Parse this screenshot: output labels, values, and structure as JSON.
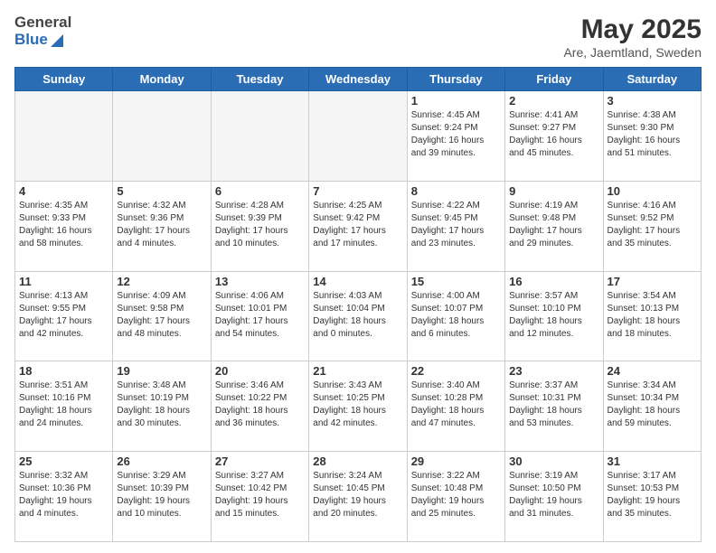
{
  "logo": {
    "general": "General",
    "blue": "Blue"
  },
  "header": {
    "month": "May 2025",
    "location": "Are, Jaemtland, Sweden"
  },
  "weekdays": [
    "Sunday",
    "Monday",
    "Tuesday",
    "Wednesday",
    "Thursday",
    "Friday",
    "Saturday"
  ],
  "weeks": [
    [
      {
        "day": "",
        "info": ""
      },
      {
        "day": "",
        "info": ""
      },
      {
        "day": "",
        "info": ""
      },
      {
        "day": "",
        "info": ""
      },
      {
        "day": "1",
        "info": "Sunrise: 4:45 AM\nSunset: 9:24 PM\nDaylight: 16 hours\nand 39 minutes."
      },
      {
        "day": "2",
        "info": "Sunrise: 4:41 AM\nSunset: 9:27 PM\nDaylight: 16 hours\nand 45 minutes."
      },
      {
        "day": "3",
        "info": "Sunrise: 4:38 AM\nSunset: 9:30 PM\nDaylight: 16 hours\nand 51 minutes."
      }
    ],
    [
      {
        "day": "4",
        "info": "Sunrise: 4:35 AM\nSunset: 9:33 PM\nDaylight: 16 hours\nand 58 minutes."
      },
      {
        "day": "5",
        "info": "Sunrise: 4:32 AM\nSunset: 9:36 PM\nDaylight: 17 hours\nand 4 minutes."
      },
      {
        "day": "6",
        "info": "Sunrise: 4:28 AM\nSunset: 9:39 PM\nDaylight: 17 hours\nand 10 minutes."
      },
      {
        "day": "7",
        "info": "Sunrise: 4:25 AM\nSunset: 9:42 PM\nDaylight: 17 hours\nand 17 minutes."
      },
      {
        "day": "8",
        "info": "Sunrise: 4:22 AM\nSunset: 9:45 PM\nDaylight: 17 hours\nand 23 minutes."
      },
      {
        "day": "9",
        "info": "Sunrise: 4:19 AM\nSunset: 9:48 PM\nDaylight: 17 hours\nand 29 minutes."
      },
      {
        "day": "10",
        "info": "Sunrise: 4:16 AM\nSunset: 9:52 PM\nDaylight: 17 hours\nand 35 minutes."
      }
    ],
    [
      {
        "day": "11",
        "info": "Sunrise: 4:13 AM\nSunset: 9:55 PM\nDaylight: 17 hours\nand 42 minutes."
      },
      {
        "day": "12",
        "info": "Sunrise: 4:09 AM\nSunset: 9:58 PM\nDaylight: 17 hours\nand 48 minutes."
      },
      {
        "day": "13",
        "info": "Sunrise: 4:06 AM\nSunset: 10:01 PM\nDaylight: 17 hours\nand 54 minutes."
      },
      {
        "day": "14",
        "info": "Sunrise: 4:03 AM\nSunset: 10:04 PM\nDaylight: 18 hours\nand 0 minutes."
      },
      {
        "day": "15",
        "info": "Sunrise: 4:00 AM\nSunset: 10:07 PM\nDaylight: 18 hours\nand 6 minutes."
      },
      {
        "day": "16",
        "info": "Sunrise: 3:57 AM\nSunset: 10:10 PM\nDaylight: 18 hours\nand 12 minutes."
      },
      {
        "day": "17",
        "info": "Sunrise: 3:54 AM\nSunset: 10:13 PM\nDaylight: 18 hours\nand 18 minutes."
      }
    ],
    [
      {
        "day": "18",
        "info": "Sunrise: 3:51 AM\nSunset: 10:16 PM\nDaylight: 18 hours\nand 24 minutes."
      },
      {
        "day": "19",
        "info": "Sunrise: 3:48 AM\nSunset: 10:19 PM\nDaylight: 18 hours\nand 30 minutes."
      },
      {
        "day": "20",
        "info": "Sunrise: 3:46 AM\nSunset: 10:22 PM\nDaylight: 18 hours\nand 36 minutes."
      },
      {
        "day": "21",
        "info": "Sunrise: 3:43 AM\nSunset: 10:25 PM\nDaylight: 18 hours\nand 42 minutes."
      },
      {
        "day": "22",
        "info": "Sunrise: 3:40 AM\nSunset: 10:28 PM\nDaylight: 18 hours\nand 47 minutes."
      },
      {
        "day": "23",
        "info": "Sunrise: 3:37 AM\nSunset: 10:31 PM\nDaylight: 18 hours\nand 53 minutes."
      },
      {
        "day": "24",
        "info": "Sunrise: 3:34 AM\nSunset: 10:34 PM\nDaylight: 18 hours\nand 59 minutes."
      }
    ],
    [
      {
        "day": "25",
        "info": "Sunrise: 3:32 AM\nSunset: 10:36 PM\nDaylight: 19 hours\nand 4 minutes."
      },
      {
        "day": "26",
        "info": "Sunrise: 3:29 AM\nSunset: 10:39 PM\nDaylight: 19 hours\nand 10 minutes."
      },
      {
        "day": "27",
        "info": "Sunrise: 3:27 AM\nSunset: 10:42 PM\nDaylight: 19 hours\nand 15 minutes."
      },
      {
        "day": "28",
        "info": "Sunrise: 3:24 AM\nSunset: 10:45 PM\nDaylight: 19 hours\nand 20 minutes."
      },
      {
        "day": "29",
        "info": "Sunrise: 3:22 AM\nSunset: 10:48 PM\nDaylight: 19 hours\nand 25 minutes."
      },
      {
        "day": "30",
        "info": "Sunrise: 3:19 AM\nSunset: 10:50 PM\nDaylight: 19 hours\nand 31 minutes."
      },
      {
        "day": "31",
        "info": "Sunrise: 3:17 AM\nSunset: 10:53 PM\nDaylight: 19 hours\nand 35 minutes."
      }
    ]
  ]
}
